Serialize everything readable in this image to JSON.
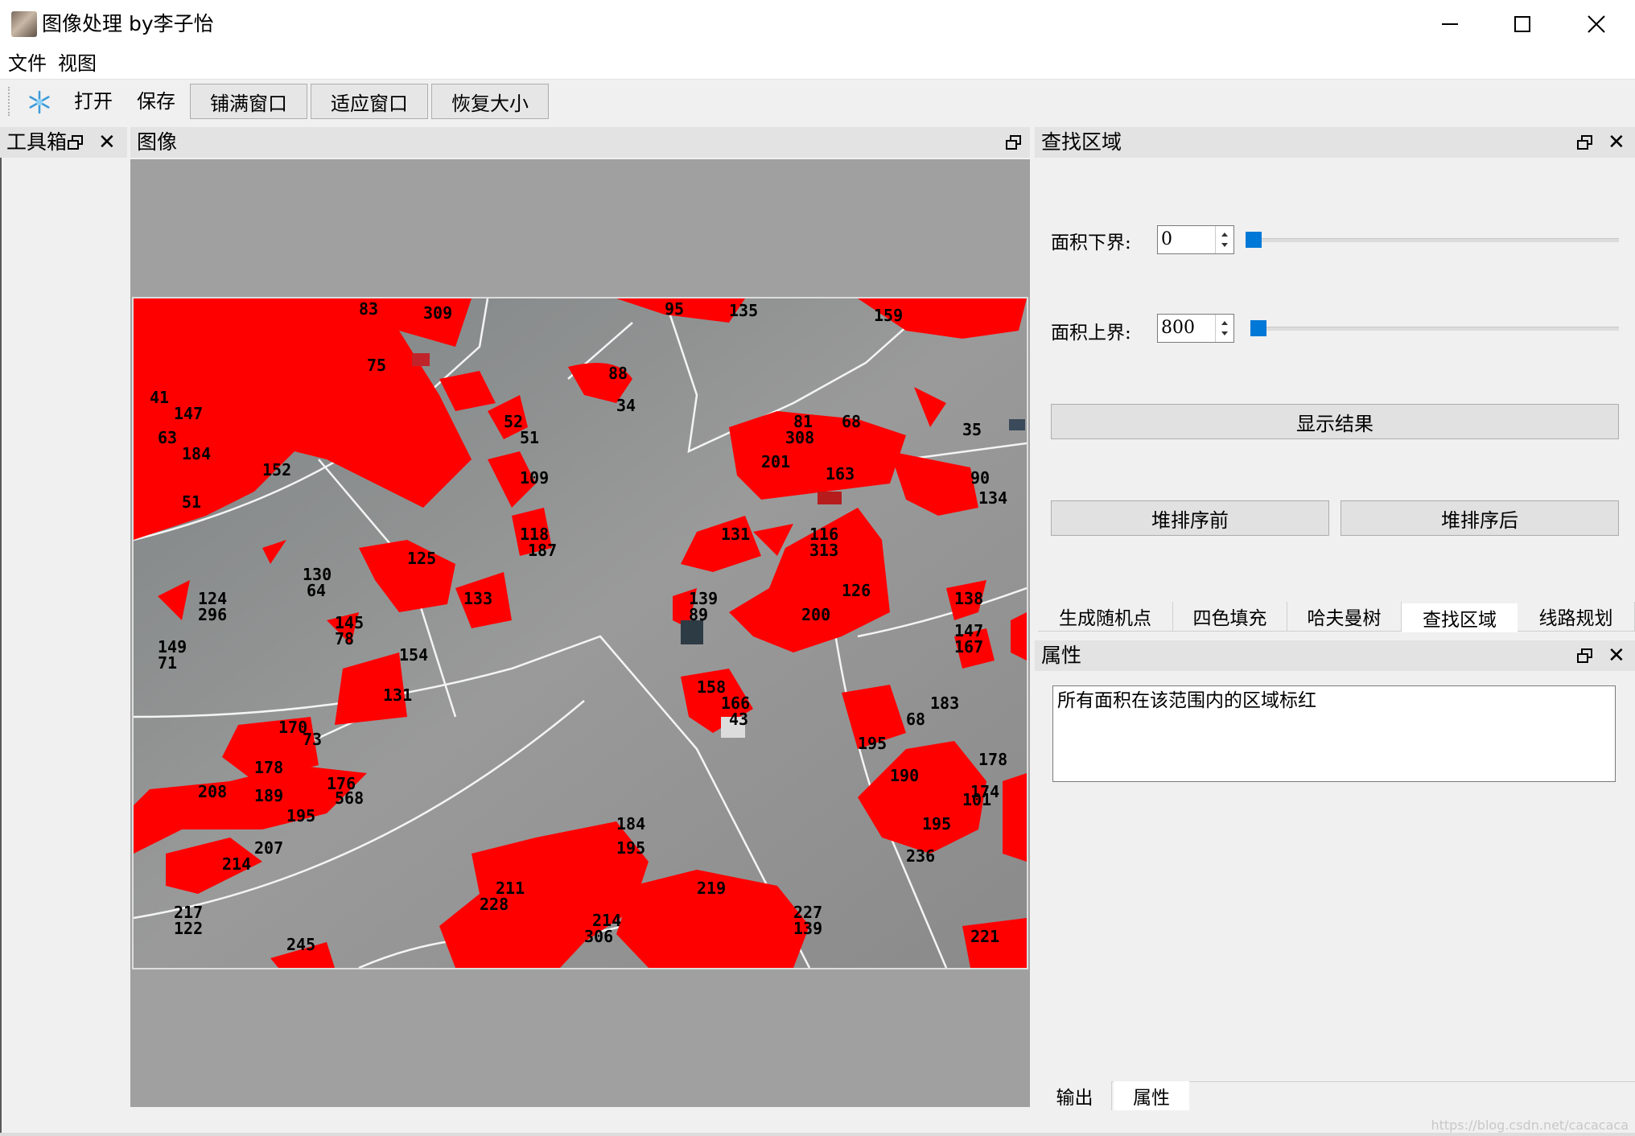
{
  "window": {
    "title": "图像处理 by李子怡",
    "minimize_icon": "minimize-icon",
    "maximize_icon": "maximize-icon",
    "close_icon": "close-icon"
  },
  "menu": [
    "文件",
    "视图"
  ],
  "toolbar": {
    "icon": "snowflake-icon",
    "open": "打开",
    "save": "保存",
    "fill_window": "铺满窗口",
    "fit_window": "适应窗口",
    "restore_size": "恢复大小"
  },
  "docks": {
    "toolbox": "工具箱",
    "image": "图像",
    "find_region": "查找区域",
    "properties": "属性"
  },
  "find_region": {
    "lower_label": "面积下界:",
    "lower_value": "0",
    "lower_slider_fraction": 0.0,
    "upper_label": "面积上界:",
    "upper_value": "800",
    "upper_slider_fraction": 0.01,
    "show_result": "显示结果",
    "heap_before": "堆排序前",
    "heap_after": "堆排序后"
  },
  "tabs": [
    "生成随机点",
    "四色填充",
    "哈夫曼树",
    "查找区域",
    "线路规划"
  ],
  "active_tab": "查找区域",
  "properties": {
    "text": "所有面积在该范围内的区域标红"
  },
  "bottom_tabs": [
    "输出",
    "属性"
  ],
  "active_bottom_tab": "属性",
  "watermark": "https://blog.csdn.net/cacacaca",
  "colors": {
    "accent": "#0078d7",
    "region_highlight": "#ff0000",
    "image_bg": "#a0a0a0"
  }
}
